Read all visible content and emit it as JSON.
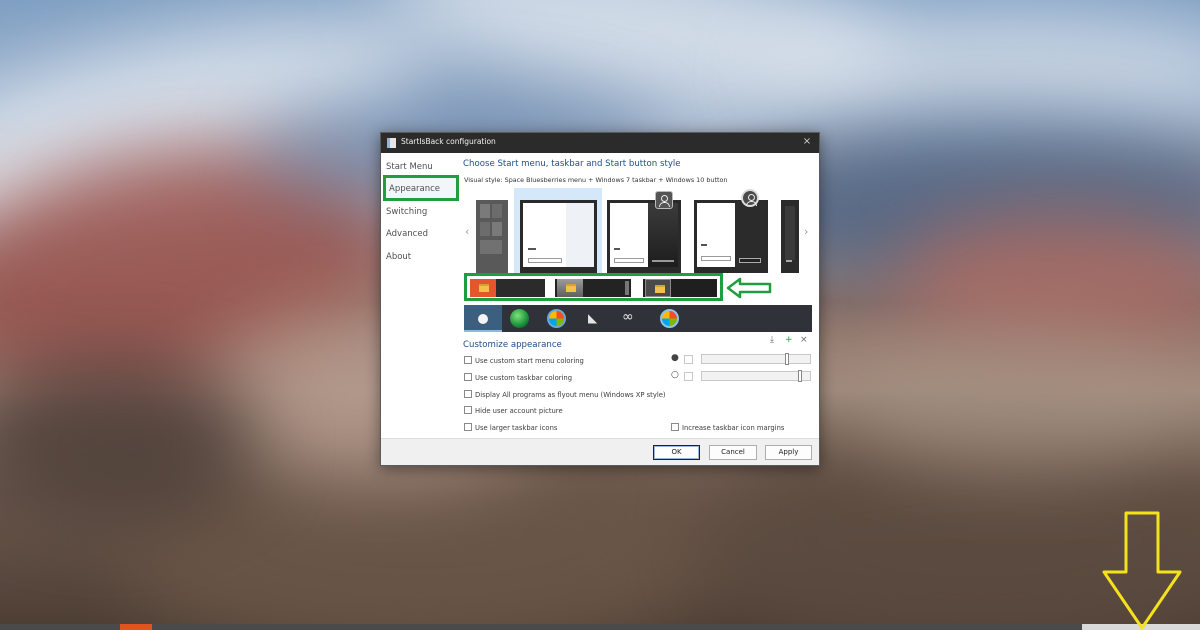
{
  "dialog": {
    "title": "StartIsBack configuration",
    "close_glyph": "×"
  },
  "nav": {
    "items": [
      {
        "label": "Start Menu",
        "selected": false
      },
      {
        "label": "Appearance",
        "selected": true
      },
      {
        "label": "Switching",
        "selected": false
      },
      {
        "label": "Advanced",
        "selected": false
      },
      {
        "label": "About",
        "selected": false
      }
    ]
  },
  "appearance": {
    "heading": "Choose Start menu, taskbar and Start button style",
    "visual_style_label": "Visual style:",
    "visual_style_value": "Space Bluesberries menu + Windows 7 taskbar + Windows 10 button",
    "prev_glyph": "‹",
    "next_glyph": "›"
  },
  "customize": {
    "heading": "Customize appearance",
    "download_glyph": "⤓",
    "add_glyph": "+",
    "remove_glyph": "×",
    "options": [
      {
        "label": "Use custom start menu coloring",
        "checked": false
      },
      {
        "label": "Use custom taskbar coloring",
        "checked": false
      },
      {
        "label": "Display All programs as flyout menu (Windows XP style)",
        "checked": false
      },
      {
        "label": "Hide user account picture",
        "checked": false
      },
      {
        "label": "Use larger taskbar icons",
        "checked": false
      }
    ],
    "margin_option": {
      "label": "Increase taskbar icon margins",
      "checked": false
    },
    "sliders": [
      {
        "name": "menu-color",
        "value": 0.85
      },
      {
        "name": "taskbar-color",
        "value": 0.95
      }
    ]
  },
  "buttons": {
    "ok": "OK",
    "cancel": "Cancel",
    "apply": "Apply"
  },
  "colors": {
    "highlight": "#1e9e3f",
    "heading": "#1f4e86",
    "titlebar": "#2b2b2b",
    "annotation_arrow": "#f4e21a"
  }
}
